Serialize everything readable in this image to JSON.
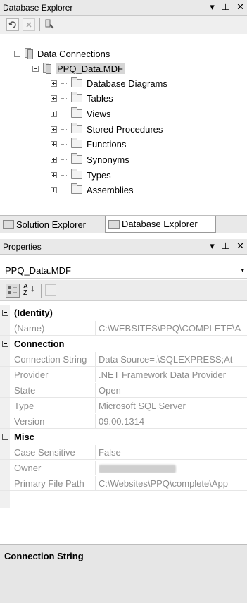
{
  "db_explorer": {
    "title": "Database Explorer",
    "tree": {
      "root": "Data Connections",
      "database": "PPQ_Data.MDF",
      "folders": [
        "Database Diagrams",
        "Tables",
        "Views",
        "Stored Procedures",
        "Functions",
        "Synonyms",
        "Types",
        "Assemblies"
      ]
    }
  },
  "tabs": [
    "Solution Explorer",
    "Database Explorer"
  ],
  "properties": {
    "title": "Properties",
    "object": "PPQ_Data.MDF",
    "sort_icon_text": "A↓Z",
    "categories": [
      {
        "name": "(Identity)",
        "rows": [
          {
            "k": "(Name)",
            "v": "C:\\WEBSITES\\PPQ\\COMPLETE\\A"
          }
        ]
      },
      {
        "name": "Connection",
        "rows": [
          {
            "k": "Connection String",
            "v": "Data Source=.\\SQLEXPRESS;At"
          },
          {
            "k": "Provider",
            "v": ".NET Framework Data Provider"
          },
          {
            "k": "State",
            "v": "Open"
          },
          {
            "k": "Type",
            "v": "Microsoft SQL Server"
          },
          {
            "k": "Version",
            "v": "09.00.1314"
          }
        ]
      },
      {
        "name": "Misc",
        "rows": [
          {
            "k": "Case Sensitive",
            "v": "False"
          },
          {
            "k": "Owner",
            "v": ""
          },
          {
            "k": "Primary File Path",
            "v": "C:\\Websites\\PPQ\\complete\\App"
          }
        ]
      }
    ],
    "description_title": "Connection String"
  },
  "controls": {
    "pin": "ᅾ",
    "close": "✕",
    "dropdown": "▾"
  }
}
